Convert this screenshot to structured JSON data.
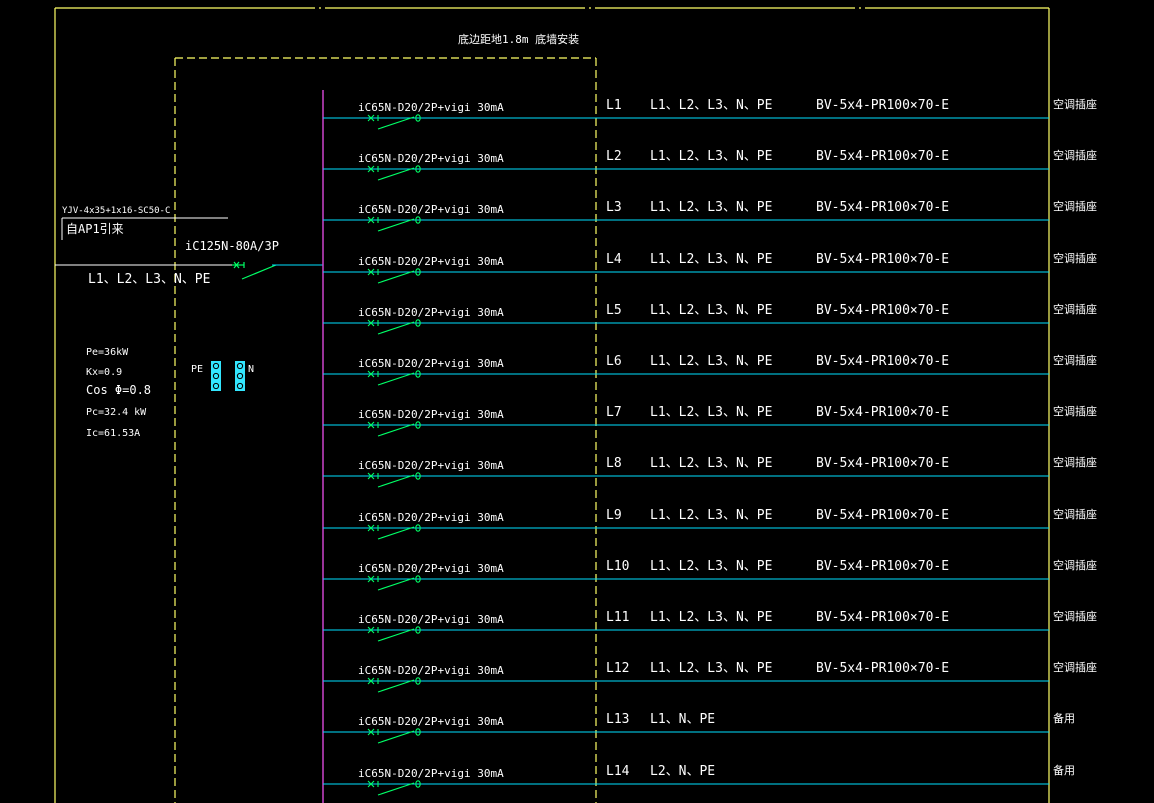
{
  "title": "底边距地1.8m 底墙安装",
  "incoming": {
    "feeder_cable": "YJV-4x35+1x16-SC50-C",
    "source": "自AP1引来",
    "main_breaker": "iC125N-80A/3P",
    "phases": "L1、L2、L3、N、PE"
  },
  "params": {
    "pe": "Pe=36kW",
    "kx": "Kx=0.9",
    "cos": "Cos Φ=0.8",
    "pc": "Pc=32.4 kW",
    "ic": "Ic=61.53A"
  },
  "bus_labels": {
    "pe": "PE",
    "n": "N"
  },
  "circuits": [
    {
      "breaker": "iC65N-D20/2P+vigi 30mA",
      "id": "L1",
      "phases": "L1、L2、L3、N、PE",
      "cable": "BV-5x4-PR100×70-E",
      "use": "空调插座"
    },
    {
      "breaker": "iC65N-D20/2P+vigi 30mA",
      "id": "L2",
      "phases": "L1、L2、L3、N、PE",
      "cable": "BV-5x4-PR100×70-E",
      "use": "空调插座"
    },
    {
      "breaker": "iC65N-D20/2P+vigi 30mA",
      "id": "L3",
      "phases": "L1、L2、L3、N、PE",
      "cable": "BV-5x4-PR100×70-E",
      "use": "空调插座"
    },
    {
      "breaker": "iC65N-D20/2P+vigi 30mA",
      "id": "L4",
      "phases": "L1、L2、L3、N、PE",
      "cable": "BV-5x4-PR100×70-E",
      "use": "空调插座"
    },
    {
      "breaker": "iC65N-D20/2P+vigi 30mA",
      "id": "L5",
      "phases": "L1、L2、L3、N、PE",
      "cable": "BV-5x4-PR100×70-E",
      "use": "空调插座"
    },
    {
      "breaker": "iC65N-D20/2P+vigi 30mA",
      "id": "L6",
      "phases": "L1、L2、L3、N、PE",
      "cable": "BV-5x4-PR100×70-E",
      "use": "空调插座"
    },
    {
      "breaker": "iC65N-D20/2P+vigi 30mA",
      "id": "L7",
      "phases": "L1、L2、L3、N、PE",
      "cable": "BV-5x4-PR100×70-E",
      "use": "空调插座"
    },
    {
      "breaker": "iC65N-D20/2P+vigi 30mA",
      "id": "L8",
      "phases": "L1、L2、L3、N、PE",
      "cable": "BV-5x4-PR100×70-E",
      "use": "空调插座"
    },
    {
      "breaker": "iC65N-D20/2P+vigi 30mA",
      "id": "L9",
      "phases": "L1、L2、L3、N、PE",
      "cable": "BV-5x4-PR100×70-E",
      "use": "空调插座"
    },
    {
      "breaker": "iC65N-D20/2P+vigi 30mA",
      "id": "L10",
      "phases": "L1、L2、L3、N、PE",
      "cable": "BV-5x4-PR100×70-E",
      "use": "空调插座"
    },
    {
      "breaker": "iC65N-D20/2P+vigi 30mA",
      "id": "L11",
      "phases": "L1、L2、L3、N、PE",
      "cable": "BV-5x4-PR100×70-E",
      "use": "空调插座"
    },
    {
      "breaker": "iC65N-D20/2P+vigi 30mA",
      "id": "L12",
      "phases": "L1、L2、L3、N、PE",
      "cable": "BV-5x4-PR100×70-E",
      "use": "空调插座"
    },
    {
      "breaker": "iC65N-D20/2P+vigi 30mA",
      "id": "L13",
      "phases": "L1、N、PE",
      "cable": "",
      "use": "备用"
    },
    {
      "breaker": "iC65N-D20/2P+vigi 30mA",
      "id": "L14",
      "phases": "L2、N、PE",
      "cable": "",
      "use": "备用"
    }
  ],
  "colors": {
    "background": "#000000",
    "frame": "#ffff66",
    "wire": "#00e0ff",
    "breaker": "#00ff66",
    "bus": "#cc44cc",
    "text": "#ffffff",
    "terminal": "#33e6ff"
  }
}
